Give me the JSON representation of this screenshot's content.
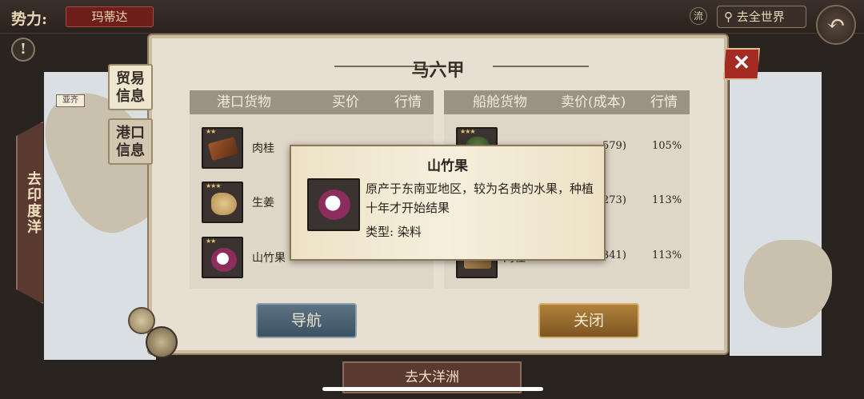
{
  "topbar": {
    "faction_label": "势力:",
    "faction_value": "玛蒂达",
    "flow_label": "流",
    "world_button": "去全世界",
    "back_icon": "back-arrow-icon"
  },
  "map": {
    "port_tag": "亚齐",
    "left_banner": "去印度洋",
    "bottom_banner": "去大洋洲"
  },
  "dialog": {
    "title": "马六甲",
    "tabs": [
      {
        "label_line1": "贸易",
        "label_line2": "信息"
      },
      {
        "label_line1": "港口",
        "label_line2": "信息"
      }
    ],
    "port_goods": {
      "headers": [
        "港口货物",
        "买价",
        "行情"
      ],
      "rows": [
        {
          "name": "肉桂",
          "stars": "★★",
          "icon": "cinnamon-icon"
        },
        {
          "name": "生姜",
          "stars": "★★★",
          "icon": "ginger-icon"
        },
        {
          "name": "山竹果",
          "stars": "★★",
          "icon": "mangosteen-icon",
          "price": "2",
          "trend": "%"
        }
      ]
    },
    "ship_goods": {
      "headers": [
        "船舱货物",
        "卖价(成本)",
        "行情"
      ],
      "rows": [
        {
          "stars": "★★★",
          "icon": "green-goods-icon",
          "price": "579)",
          "trend": "105%"
        },
        {
          "stars": "",
          "icon": "goods-icon",
          "price": "273)",
          "trend": "113%"
        },
        {
          "stars": "",
          "icon": "goods-icon",
          "name": "肉桂",
          "price": "341)",
          "trend": "113%"
        }
      ]
    },
    "nav_button": "导航",
    "close_button": "关闭"
  },
  "tooltip": {
    "title": "山竹果",
    "description": "原产于东南亚地区，较为名贵的水果，种植十年才开始结果",
    "type": "类型: 染料"
  }
}
